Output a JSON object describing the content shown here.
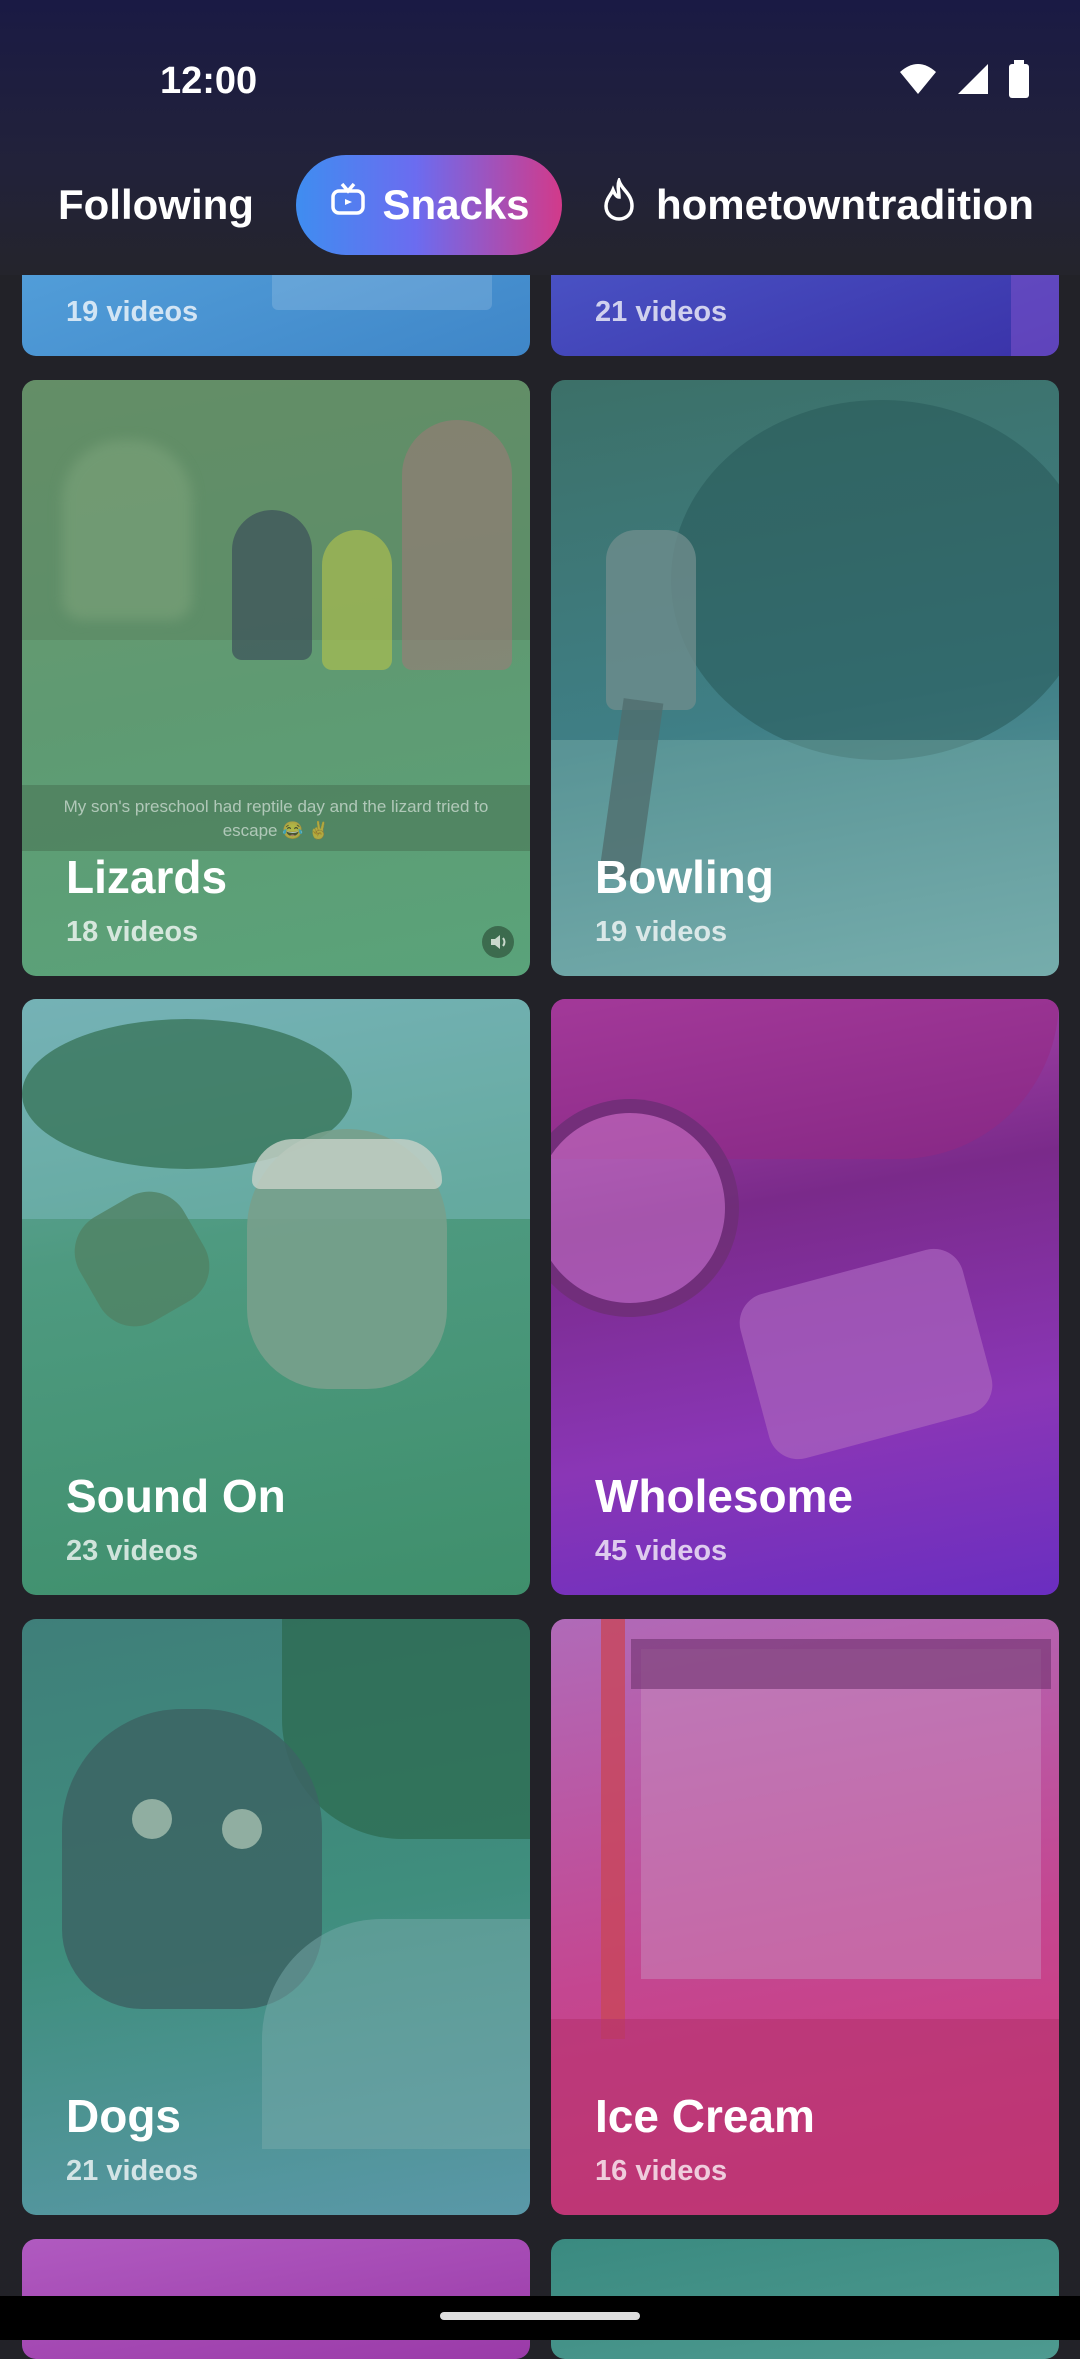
{
  "status": {
    "time": "12:00"
  },
  "tabs": [
    {
      "label": "Following"
    },
    {
      "label": "Snacks"
    },
    {
      "label": "hometowntradition"
    }
  ],
  "cards": [
    {
      "title": "",
      "count": "19 videos",
      "color": "#4a9fd8"
    },
    {
      "title": "",
      "count": "21 videos",
      "color": "#4a44b8"
    },
    {
      "title": "Lizards",
      "count": "18 videos",
      "caption": "My son's preschool had reptile day and the lizard tried to escape 😂 ✌️",
      "color": "#5e9a70"
    },
    {
      "title": "Bowling",
      "count": "19 videos",
      "color": "#3e7f86"
    },
    {
      "title": "Sound On",
      "count": "23 videos",
      "color": "#3f8a72"
    },
    {
      "title": "Wholesome",
      "count": "45 videos",
      "color": "#8a36b6"
    },
    {
      "title": "Dogs",
      "count": "21 videos",
      "color": "#3f8e7d"
    },
    {
      "title": "Ice Cream",
      "count": "16 videos",
      "color": "#c44690"
    }
  ],
  "icons": {
    "snacks": "tv-icon",
    "trend": "flame-icon",
    "volume": "volume-icon"
  }
}
